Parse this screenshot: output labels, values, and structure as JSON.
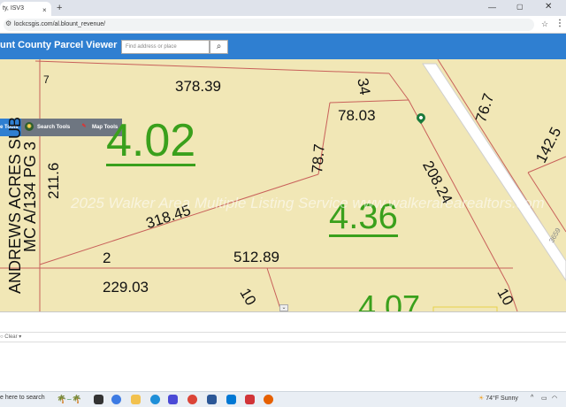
{
  "browser": {
    "tab_title": "ty, ISV3",
    "tab_close": "×",
    "new_tab": "+",
    "url": "lockcsgis.com/al.blount_revenue/",
    "window_min": "—",
    "window_max": "▢",
    "window_close": "✕"
  },
  "app": {
    "title": "unt County Parcel Viewer",
    "search_placeholder": "Find address or place",
    "search_icon": "search-icon",
    "toolbar": {
      "base_tools": "e Tools",
      "search_tools": "Search Tools",
      "map_tools": "Map Tools"
    }
  },
  "map": {
    "labels": {
      "l378": "378.39",
      "l34": "34",
      "l78_03": "78.03",
      "l78_7": "78.7",
      "l208": "208.24",
      "l76": "76.7",
      "l142": "142.5",
      "l211": "211.6",
      "l318": "318.45",
      "l2": "2",
      "l512": "512.89",
      "l229": "229.03",
      "l10a": "10",
      "l10b": "10",
      "l7": "7",
      "road": "3659",
      "subdivision": "ANDREWS ACRES SUB",
      "mc": "MC A/134 PG 3"
    },
    "acres": {
      "a402": "4.02",
      "a436": "4.36",
      "a407": "4.07"
    },
    "watermark": "2025 Walker Area Multiple Listing Service www.walkerarearealtors.com",
    "colors": {
      "parcel_fill": "#f1e7b6",
      "parcel_line": "#c8605a",
      "acre_text": "#3aa01c",
      "header_blue": "#2f7fd1"
    }
  },
  "lower_panel": {
    "clear_label": "Clear"
  },
  "taskbar": {
    "search": "e here to search",
    "weather": "74°F Sunny",
    "weather_icon": "sun-icon"
  }
}
